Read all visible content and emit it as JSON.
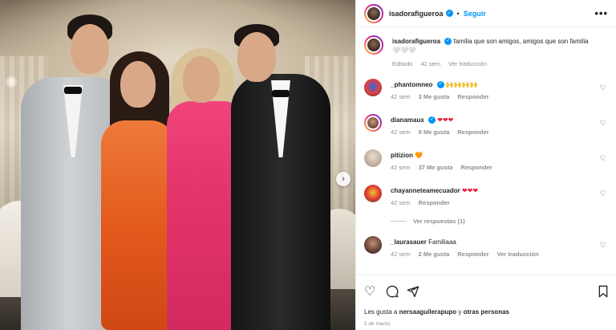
{
  "colors": {
    "accent": "#0095f6",
    "heart_red": "#ed1c3c",
    "orange_heart": "#f08a1c"
  },
  "photo": {
    "alt": "",
    "next_icon": "chevron-right-icon"
  },
  "header": {
    "username": "isadorafigueroa",
    "separator": "•",
    "follow_label": "Seguir",
    "more_icon": "•••"
  },
  "caption": {
    "username": "isadorafigueroa",
    "text": "familia que son amigos, amigos que son familia🤍🤍🤍",
    "edited": "Editado",
    "time": "42 sem",
    "translate": "Ver traducción"
  },
  "comments": [
    {
      "username": "_phantomneo",
      "text": "🙌🙌🙌🙌",
      "time": "42 sem",
      "likes": "3 Me gusta",
      "reply": "Responder"
    },
    {
      "username": "dianamaux",
      "text": "❤❤❤",
      "time": "42 sem",
      "likes": "9 Me gusta",
      "reply": "Responder"
    },
    {
      "username": "pitizion",
      "text": "🧡",
      "time": "42 sem",
      "likes": "37 Me gusta",
      "reply": "Responder"
    },
    {
      "username": "chayanneteamecuador",
      "text": "❤❤❤",
      "time": "42 sem",
      "reply": "Responder",
      "view_replies": "Ver respuestas (1)"
    },
    {
      "username": "_laurasauer",
      "text": "Familiaaa",
      "time": "42 sem",
      "likes": "2 Me gusta",
      "reply": "Responder",
      "translate": "Ver traducción"
    }
  ],
  "footer": {
    "likes_prefix": "Les gusta a ",
    "likes_user": "nersaaguilerapupo",
    "likes_suffix": " y ",
    "likes_others": "otras personas",
    "date": "5 de marzo"
  }
}
